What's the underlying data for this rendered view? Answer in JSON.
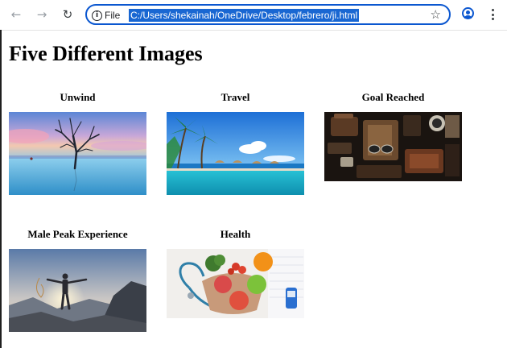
{
  "browser": {
    "url_prefix": "File",
    "url": "C:/Users/shekainah/OneDrive/Desktop/febrero/ji.html",
    "icons": [
      "back-icon",
      "forward-icon",
      "reload-icon",
      "info-icon",
      "star-icon",
      "profile-icon",
      "menu-icon"
    ]
  },
  "page": {
    "title": "Five Different Images",
    "cards": [
      {
        "title": "Unwind"
      },
      {
        "title": "Travel"
      },
      {
        "title": "Goal Reached"
      },
      {
        "title": "Male Peak Experience"
      },
      {
        "title": "Health"
      }
    ]
  },
  "colors": {
    "accent": "#0b57d0",
    "selection": "#1967d2",
    "text": "#000000"
  }
}
